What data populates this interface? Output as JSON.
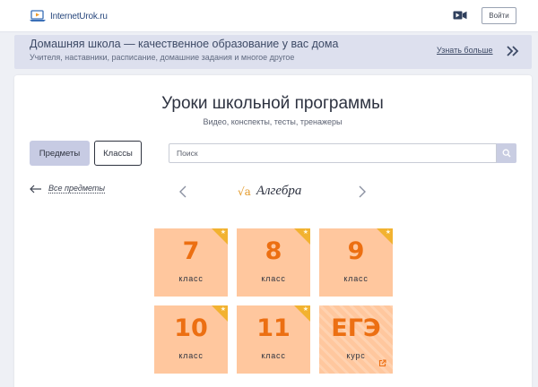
{
  "header": {
    "site_name": "InternetUrok.ru",
    "login_label": "Войти"
  },
  "promo": {
    "title": "Домашняя школа — качественное образование у вас дома",
    "subtitle": "Учителя, наставники, расписание, домашние задания и многое другое",
    "link_label": "Узнать больше"
  },
  "main": {
    "title": "Уроки школьной программы",
    "subtitle": "Видео, конспекты, тесты, тренажеры",
    "tabs": [
      {
        "label": "Предметы",
        "active": true
      },
      {
        "label": "Классы",
        "active": false
      }
    ],
    "search_placeholder": "Поиск",
    "back_label": "Все предметы",
    "subject_icon": "√a",
    "subject_name": "Алгебра",
    "tiles": [
      {
        "number": "7",
        "word": "класс",
        "starred": true
      },
      {
        "number": "8",
        "word": "класс",
        "starred": true
      },
      {
        "number": "9",
        "word": "класс",
        "starred": true
      },
      {
        "number": "10",
        "word": "класс",
        "starred": true
      },
      {
        "number": "11",
        "word": "класс",
        "starred": true
      },
      {
        "number": "ЕГЭ",
        "word": "курс",
        "external": true
      }
    ]
  },
  "colors": {
    "accent_orange": "#ec6f12",
    "tile_bg": "#ffc79e",
    "corner": "#f2b230",
    "banner_bg": "#dde0ee"
  }
}
